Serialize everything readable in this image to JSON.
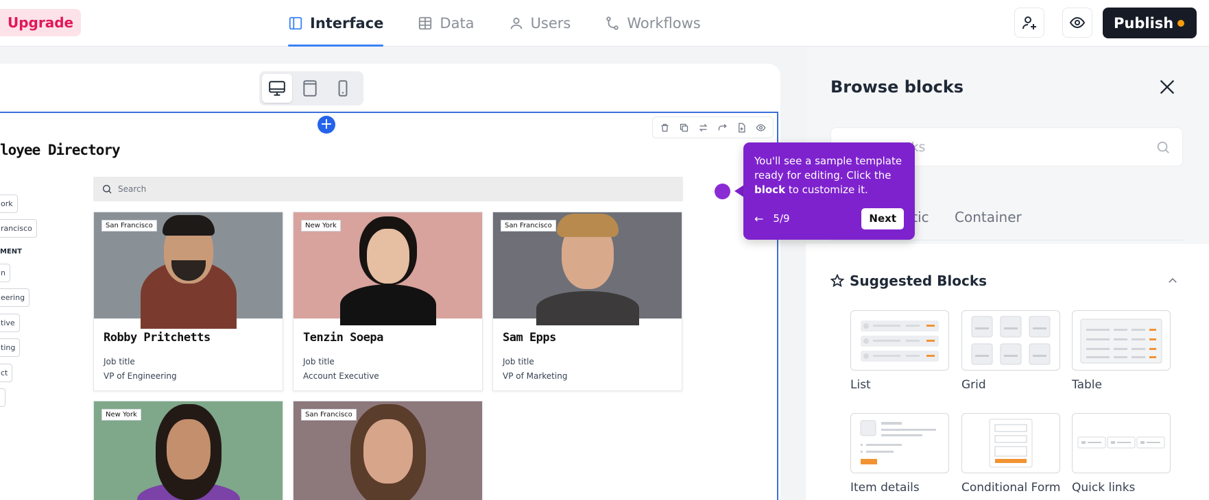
{
  "header": {
    "upgrade_label": "Upgrade",
    "tabs": [
      {
        "label": "Interface",
        "icon": "layout-icon",
        "active": true
      },
      {
        "label": "Data",
        "icon": "table-icon",
        "active": false
      },
      {
        "label": "Users",
        "icon": "user-icon",
        "active": false
      },
      {
        "label": "Workflows",
        "icon": "workflow-icon",
        "active": false
      }
    ],
    "publish_label": "Publish",
    "accent": "#3b82f6"
  },
  "canvas": {
    "directory_title": "loyee Directory",
    "search_placeholder": "Search",
    "filters": [
      "ork",
      "rancisco",
      "MENT",
      "n",
      "eering",
      "tive",
      "ting",
      "ct"
    ],
    "employees": [
      {
        "name": "Robby Pritchetts",
        "job_label": "Job title",
        "title": "VP of Engineering",
        "location": "San Francisco"
      },
      {
        "name": "Tenzin Soepa",
        "job_label": "Job title",
        "title": "Account Executive",
        "location": "New York"
      },
      {
        "name": "Sam Epps",
        "job_label": "Job title",
        "title": "VP of Marketing",
        "location": "San Francisco"
      },
      {
        "name": "",
        "job_label": "",
        "title": "",
        "location": "New York"
      },
      {
        "name": "",
        "job_label": "",
        "title": "",
        "location": "San Francisco"
      }
    ]
  },
  "tooltip": {
    "text_before": "You'll see a sample template ready for editing. Click the ",
    "text_bold": "block",
    "text_after": " to customize it.",
    "step": "5/9",
    "next_label": "Next",
    "color": "#7e22ce"
  },
  "panel": {
    "title": "Browse blocks",
    "search_placeholder": "cks",
    "tab_partial": "atic",
    "tab_container": "Container",
    "suggested_title": "Suggested Blocks",
    "blocks": [
      "List",
      "Grid",
      "Table",
      "Item details",
      "Conditional Form",
      "Quick links"
    ]
  }
}
